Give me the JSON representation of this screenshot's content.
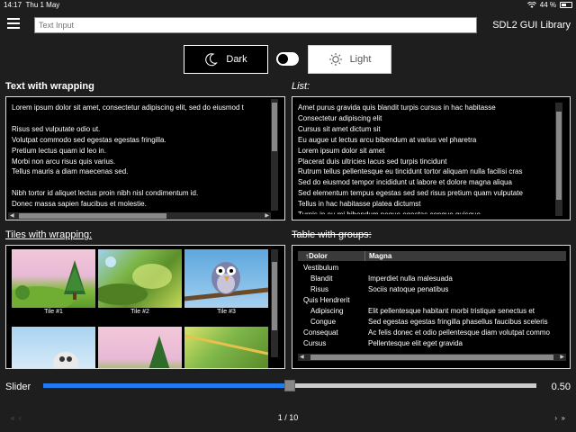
{
  "status": {
    "time": "14:17",
    "date": "Thu 1 May",
    "battery": "44 %"
  },
  "header": {
    "placeholder": "Text Input",
    "title": "SDL2 GUI Library"
  },
  "theme": {
    "dark_label": "Dark",
    "light_label": "Light",
    "toggle_on": false
  },
  "text_wrap": {
    "title": "Text with wrapping",
    "lines": [
      "Lorem ipsum dolor sit amet, consectetur adipiscing elit, sed do eiusmod t",
      "",
      "Risus sed vulputate odio ut.",
      "Volutpat commodo sed egestas egestas fringilla.",
      "Pretium lectus quam id leo in.",
      "Morbi non arcu risus quis varius.",
      "Tellus mauris a diam maecenas sed.",
      "",
      "Nibh tortor id aliquet lectus proin nibh nisl condimentum id.",
      "Donec massa sapien faucibus et molestie."
    ]
  },
  "list": {
    "title": "List:",
    "items": [
      "Amet purus gravida quis blandit turpis cursus in hac habitasse",
      "Consectetur adipiscing elit",
      "Cursus sit amet dictum sit",
      "Eu augue ut lectus arcu bibendum at varius vel pharetra",
      "Lorem ipsum dolor sit amet",
      "Placerat duis ultricies lacus sed turpis tincidunt",
      "Rutrum tellus pellentesque eu tincidunt tortor aliquam nulla facilisi cras",
      "Sed do eiusmod tempor incididunt ut labore et dolore magna aliqua",
      "Sed elementum tempus egestas sed sed risus pretium quam vulputate",
      "Tellus in hac habitasse platea dictumst",
      "Turpis in eu mi bibendum neque egestas congue quisque"
    ]
  },
  "tiles": {
    "title": "Tiles with wrapping:",
    "items": [
      {
        "caption": "Tile #1"
      },
      {
        "caption": "Tile #2"
      },
      {
        "caption": "Tile #3"
      },
      {
        "caption": ""
      },
      {
        "caption": ""
      },
      {
        "caption": ""
      }
    ]
  },
  "table": {
    "title": "Table with groups:",
    "col1": "↑Dolor",
    "col2": "Magna",
    "rows": [
      {
        "c1": "Vestibulum",
        "c2": "",
        "indent": 0
      },
      {
        "c1": "Blandit",
        "c2": "Imperdiet nulla malesuada",
        "indent": 1
      },
      {
        "c1": "Risus",
        "c2": "Sociis natoque penatibus",
        "indent": 1
      },
      {
        "c1": "Quis Hendrerit",
        "c2": "",
        "indent": 0
      },
      {
        "c1": "Adipiscing",
        "c2": "Elit pellentesque habitant morbi tristique senectus et",
        "indent": 1
      },
      {
        "c1": "Congue",
        "c2": "Sed egestas egestas fringilla phasellus faucibus sceleris",
        "indent": 1
      },
      {
        "c1": "Consequat",
        "c2": "Ac felis donec et odio pellentesque diam volutpat commo",
        "indent": 0
      },
      {
        "c1": "Cursus",
        "c2": "Pellentesque elit eget gravida",
        "indent": 0
      }
    ]
  },
  "slider": {
    "label": "Slider",
    "value_text": "0.50",
    "value": 0.5
  },
  "pager": {
    "label": "1 / 10",
    "first": "«",
    "prev": "‹",
    "next": "›",
    "last": "»"
  },
  "colors": {
    "accent": "#1e7bf2",
    "background": "#1e1e1e",
    "panel": "#000000"
  }
}
